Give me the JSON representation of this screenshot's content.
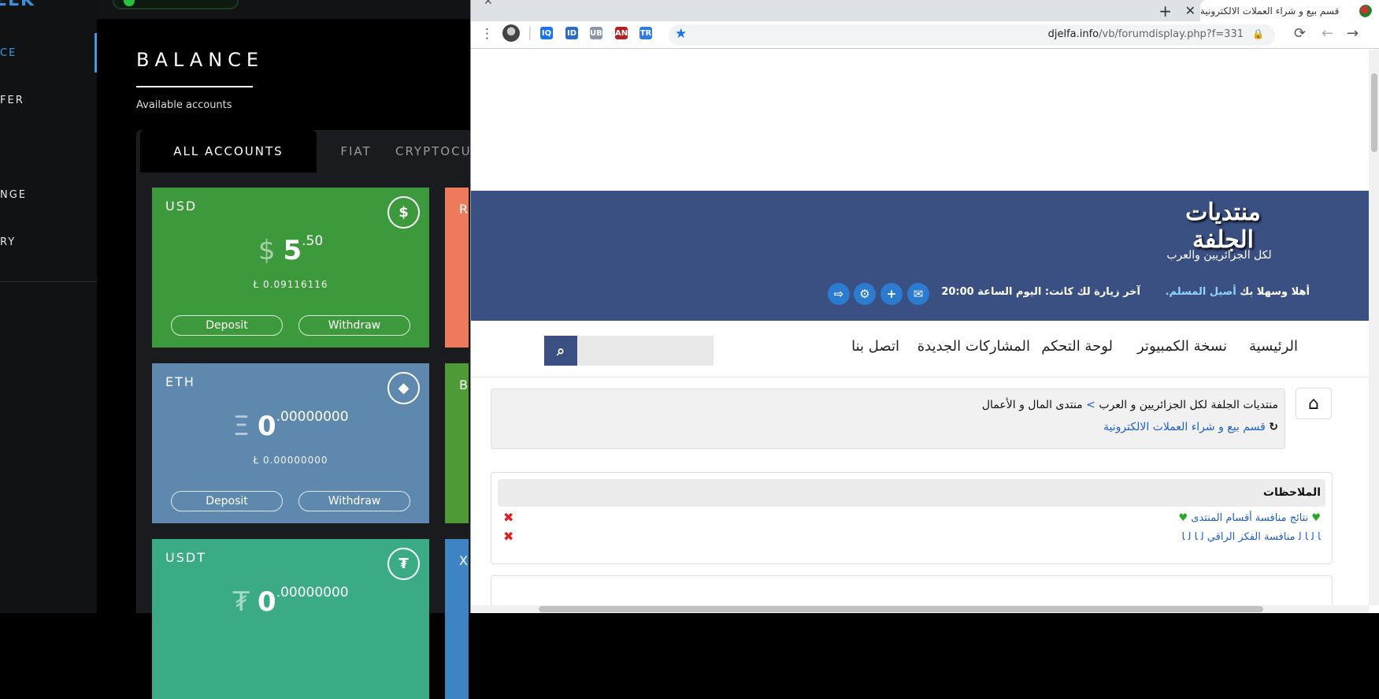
{
  "sidebar": {
    "logo": "EEK",
    "items": [
      {
        "label": "CE",
        "active": true
      },
      {
        "label": "FER",
        "active": false
      },
      {
        "label": "NGE",
        "active": false
      },
      {
        "label": "RY",
        "active": false
      }
    ]
  },
  "balance": {
    "title": "BALANCE",
    "subtitle": "Available accounts",
    "tabs": [
      "ALL ACCOUNTS",
      "FIAT",
      "CRYPTOCU"
    ],
    "cards": [
      {
        "code": "USD",
        "icon": "$",
        "symbol": "$",
        "amount": "5",
        "decimals": ".50",
        "sub": "Ł 0.09116116",
        "deposit": "Deposit",
        "withdraw": "Withdraw",
        "color": "#3c9a3c"
      },
      {
        "code": "ETH",
        "icon": "◆",
        "symbol": "Ξ",
        "amount": "0",
        "decimals": ".00000000",
        "sub": "Ł 0.00000000",
        "deposit": "Deposit",
        "withdraw": "Withdraw",
        "color": "#5e88ad"
      },
      {
        "code": "USDT",
        "icon": "₮",
        "symbol": "₮",
        "amount": "0",
        "decimals": ".00000000",
        "color": "#3aab85"
      }
    ],
    "peek_cards": [
      {
        "label": "R",
        "color": "#ee7a5c"
      },
      {
        "label": "B",
        "color": "#4e9a36"
      },
      {
        "label": "X",
        "color": "#3d84c4"
      }
    ]
  },
  "browser": {
    "tab_title": "قسم بيع و شراء العملات الالكترونية",
    "url_domain": "djelfa.info",
    "url_path": "/vb/forumdisplay.php?f=331",
    "extensions": [
      "IQ",
      "ID",
      "UB",
      "AN",
      "TR"
    ]
  },
  "forum": {
    "logo_main": "منتديات الجلفة",
    "logo_sub": "لكل الجزائريين والعرب",
    "welcome_prefix": "أهلا وسهلا بك",
    "welcome_user": "أصيل المسلم.",
    "last_visit": "آخر زيارة لك كانت: اليوم الساعة 20:00",
    "nav": [
      "الرئيسية",
      "نسخة الكمبيوتر",
      "لوحة التحكم",
      "المشاركات الجديدة",
      "اتصل بنا"
    ],
    "breadcrumb_root": "منتديات الجلفة لكل الجزائريين و العرب",
    "breadcrumb_sep": ">",
    "breadcrumb_section": "منتدى المال و الأعمال",
    "breadcrumb_current": "قسم بيع و شراء العملات الالكترونية",
    "notes_title": "الملاحظات",
    "notes": [
      "نتائج منافسة أقسام المنتدى",
      "ﺎ ﻟ ﺎ ﻟ منافسة الفكر الراقي ﻟ ﺎ ﻟ ﺎ"
    ]
  }
}
